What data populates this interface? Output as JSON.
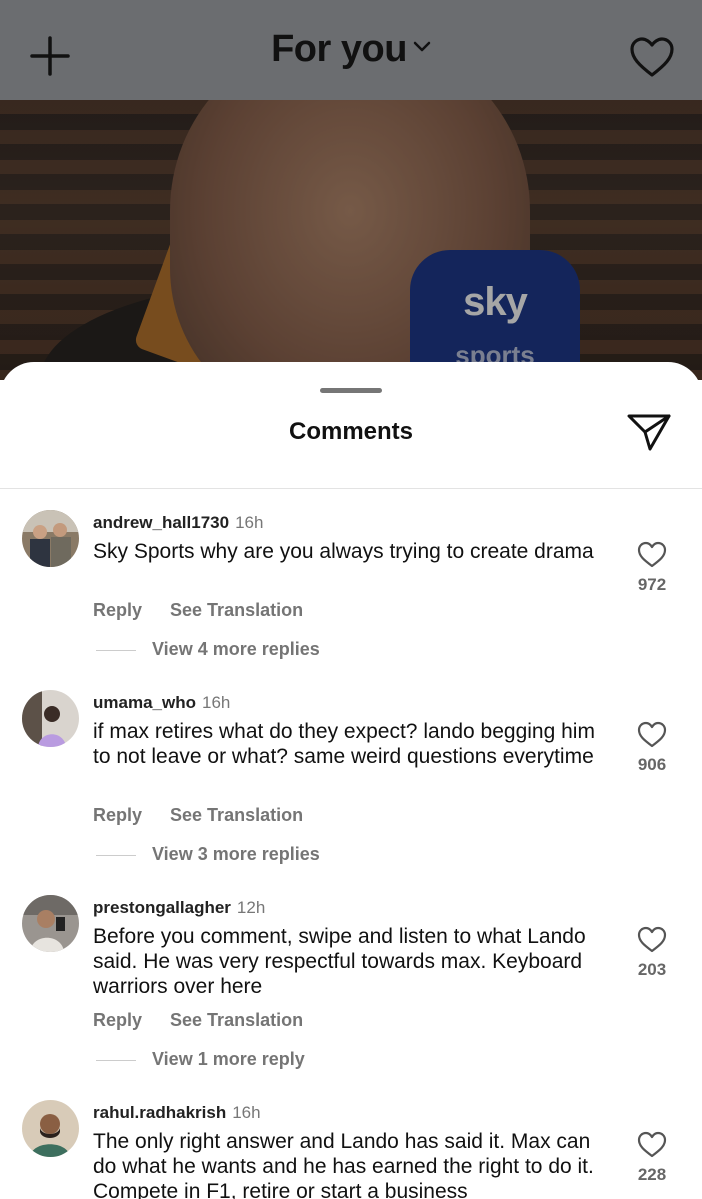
{
  "header": {
    "title": "For you"
  },
  "video": {
    "mic_brand": "sky",
    "mic_sub": "sports"
  },
  "comments_sheet": {
    "title": "Comments",
    "comments": [
      {
        "user": "andrew_hall1730",
        "time": "16h",
        "text": "Sky Sports why are you always trying to create drama",
        "reply_label": "Reply",
        "translate_label": "See Translation",
        "view_replies": "View 4 more replies",
        "likes": "972"
      },
      {
        "user": "umama_who",
        "time": "16h",
        "text": "if max retires what do they expect? lando begging him to not leave or what? same weird questions everytime",
        "reply_label": "Reply",
        "translate_label": "See Translation",
        "view_replies": "View 3 more replies",
        "likes": "906"
      },
      {
        "user": "prestongallagher",
        "time": "12h",
        "text": "Before you comment, swipe and listen to what Lando said. He was very respectful towards max. Keyboard warriors over here",
        "reply_label": "Reply",
        "translate_label": "See Translation",
        "view_replies": "View 1 more reply",
        "likes": "203"
      },
      {
        "user": "rahul.radhakrish",
        "time": "16h",
        "text": "The only right answer and Lando has said it. Max can do what he wants and he has earned the right to do it. Compete in F1, retire or start a business",
        "likes": "228"
      }
    ]
  }
}
